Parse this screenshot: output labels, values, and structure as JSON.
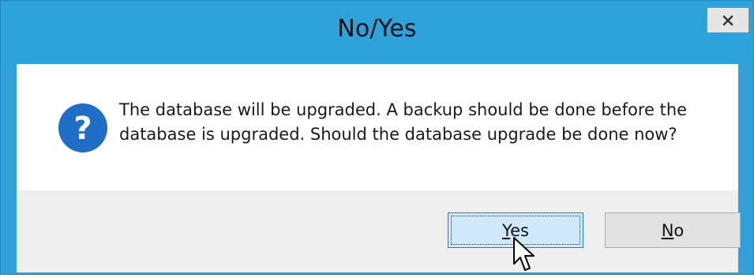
{
  "window": {
    "title": "No/Yes",
    "close_icon": "close-icon"
  },
  "dialog": {
    "icon": "question-icon",
    "message": "The database will be upgraded. A backup should be done before the database is upgraded. Should the database upgrade be done now?"
  },
  "buttons": {
    "yes": {
      "accel": "Y",
      "rest": "es"
    },
    "no": {
      "accel": "N",
      "rest": "o"
    }
  },
  "colors": {
    "titlebar": "#2ea3db",
    "question_icon": "#1f6ec8",
    "focused_button": "#cfe9fa"
  },
  "cursor": "arrow-pointer"
}
